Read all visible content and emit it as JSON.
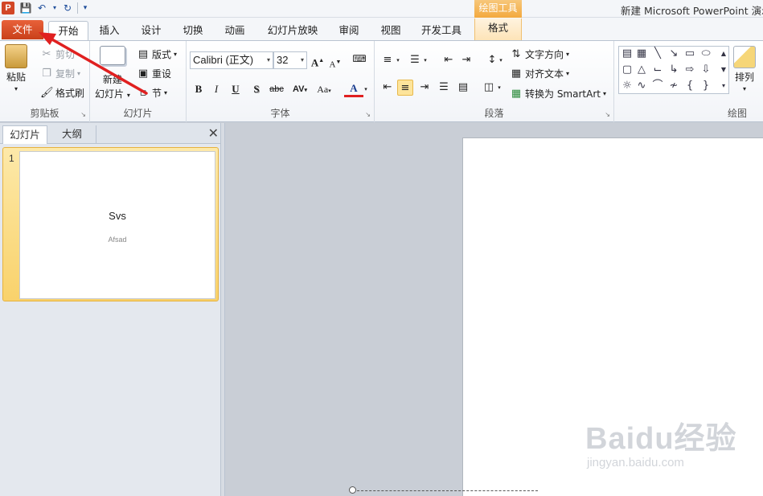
{
  "titlebar": {
    "app_icon_letter": "P",
    "title": "新建 Microsoft PowerPoint 演示",
    "context_group": "绘图工具",
    "qat": [
      "save-icon",
      "undo-icon",
      "redo-icon",
      "customize-icon"
    ]
  },
  "tabs": [
    "文件",
    "开始",
    "插入",
    "设计",
    "切换",
    "动画",
    "幻灯片放映",
    "审阅",
    "视图",
    "开发工具",
    "格式"
  ],
  "ribbon": {
    "clipboard": {
      "label": "剪贴板",
      "paste": "粘贴",
      "cut": "剪切",
      "copy": "复制",
      "format_painter": "格式刷"
    },
    "slides": {
      "label": "幻灯片",
      "new_slide_1": "新建",
      "new_slide_2": "幻灯片",
      "layout": "版式",
      "reset": "重设",
      "section": "节"
    },
    "font": {
      "label": "字体",
      "font_name": "Calibri (正文)",
      "font_size": "32",
      "bold": "B",
      "italic": "I",
      "underline": "U",
      "shadow": "S",
      "strike": "abc",
      "spacing": "AV",
      "case": "Aa",
      "color": "A",
      "grow": "A",
      "shrink": "A"
    },
    "paragraph": {
      "label": "段落",
      "text_direction": "文字方向",
      "align_text": "对齐文本",
      "smartart": "转换为 SmartArt"
    },
    "drawing": {
      "label": "绘图",
      "arrange": "排列"
    }
  },
  "left_panel": {
    "tabs": [
      "幻灯片",
      "大纲"
    ],
    "slide_number": "1",
    "thumb_title": "Svs",
    "thumb_subtitle": "Afsad"
  },
  "watermark": {
    "brand": "Baidu经验",
    "url": "jingyan.baidu.com"
  },
  "colors": {
    "file_tab": "#d24726",
    "accent_red": "#e02020",
    "context": "#f3a93e",
    "selected": "#fde49b"
  }
}
